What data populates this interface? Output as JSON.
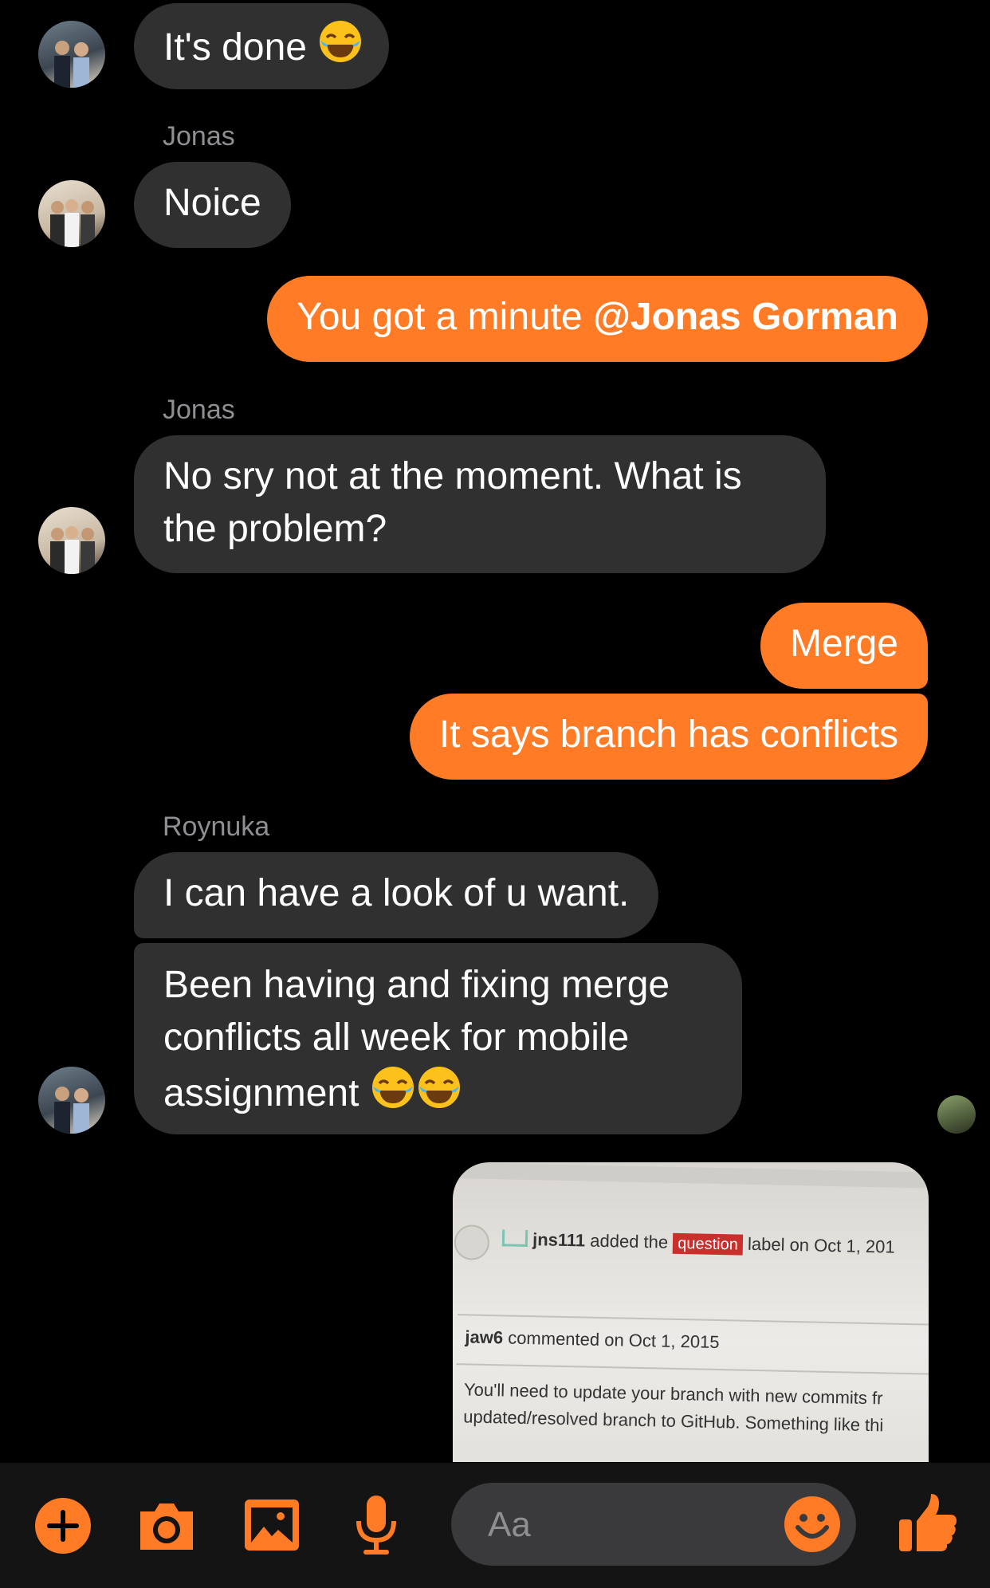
{
  "colors": {
    "accent": "#ff7b25",
    "incoming_bubble": "#303030",
    "background": "#000000"
  },
  "messages": {
    "m1": {
      "text": "It's done"
    },
    "m2": {
      "sender": "Jonas",
      "text": "Noice"
    },
    "m3": {
      "text_prefix": "You got a minute ",
      "mention": "@Jonas Gorman"
    },
    "m4": {
      "sender": "Jonas",
      "line1": "No sry not at the moment. What is",
      "line2": "the problem?"
    },
    "m5": {
      "text": "Merge"
    },
    "m6": {
      "text": "It says branch has conflicts"
    },
    "m7": {
      "sender": "Roynuka",
      "text": "I can have a look of u want."
    },
    "m8": {
      "line1": "Been having and fixing merge",
      "line2": "conflicts all week for mobile",
      "line3": "assignment"
    }
  },
  "attachment": {
    "line1_user": "jns111",
    "line1_text": "added the",
    "line1_label": "question",
    "line1_tail": "label on Oct 1, 201",
    "line2_user": "jaw6",
    "line2_text": "commented on Oct 1, 2015",
    "line3": "You'll need to update your branch with new commits fr",
    "line4": "updated/resolved branch to GitHub. Something like thi"
  },
  "composer": {
    "placeholder": "Aa"
  },
  "icons": [
    "plus-icon",
    "camera-icon",
    "image-icon",
    "microphone-icon",
    "emoji-icon",
    "thumbs-up-icon",
    "laughing-emoji-icon"
  ]
}
